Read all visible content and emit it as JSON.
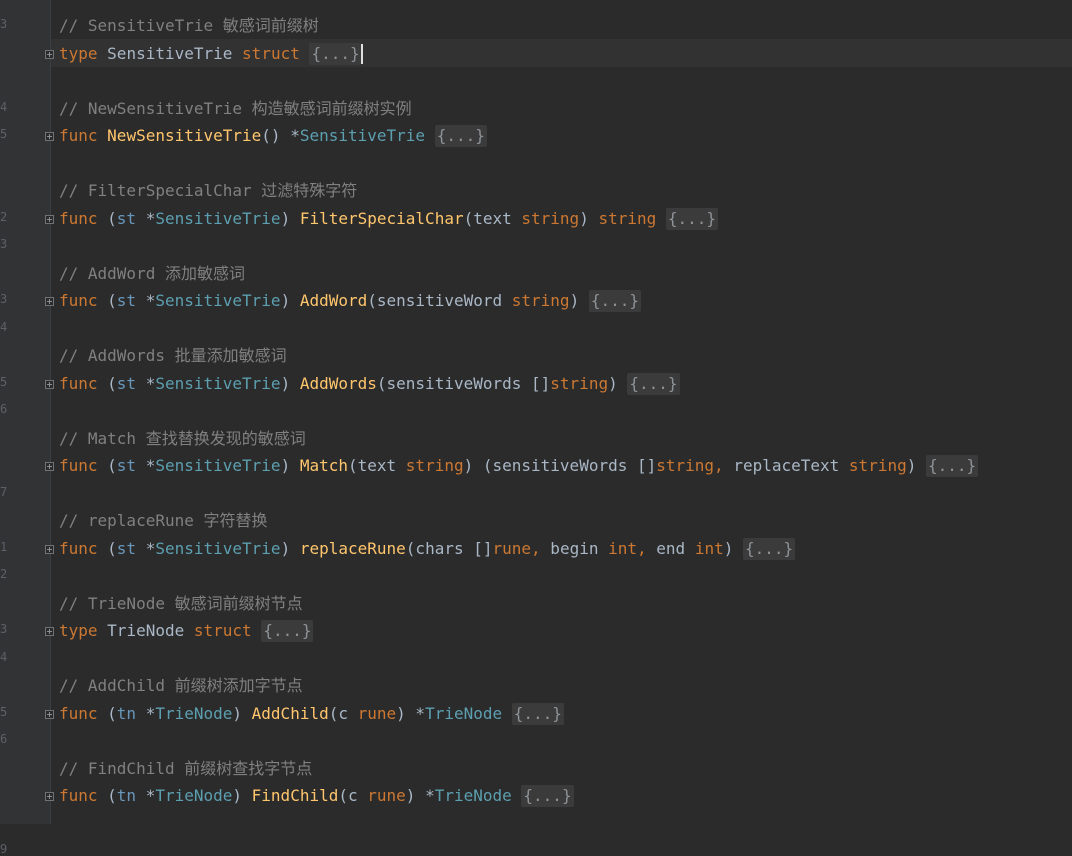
{
  "gutter": {
    "numbers": [
      "3",
      "",
      "",
      "4",
      "5",
      "",
      "",
      "2",
      "3",
      "",
      "3",
      "4",
      "",
      "5",
      "6",
      "",
      "",
      "7",
      "",
      "1",
      "2",
      "",
      "3",
      "4",
      "",
      "5",
      "6",
      "",
      "",
      "",
      "9",
      ""
    ]
  },
  "code": {
    "lines": [
      {
        "type": "comment",
        "text": "// SensitiveTrie 敏感词前缀树"
      },
      {
        "type": "decl",
        "tokens": [
          [
            "kw",
            "type"
          ],
          [
            "pl",
            " "
          ],
          [
            "tyd",
            "SensitiveTrie"
          ],
          [
            "pl",
            " "
          ],
          [
            "kw",
            "struct"
          ],
          [
            "pl",
            " "
          ]
        ],
        "folded": "{...}",
        "caret": true
      },
      {
        "type": "comment",
        "text": "// NewSensitiveTrie 构造敏感词前缀树实例"
      },
      {
        "type": "decl",
        "tokens": [
          [
            "kw",
            "func"
          ],
          [
            "pl",
            " "
          ],
          [
            "fn",
            "NewSensitiveTrie"
          ],
          [
            "pl",
            "() *"
          ],
          [
            "sty",
            "SensitiveTrie"
          ],
          [
            "pl",
            " "
          ]
        ],
        "folded": "{...}"
      },
      {
        "type": "comment",
        "text": "// FilterSpecialChar 过滤特殊字符"
      },
      {
        "type": "decl",
        "tokens": [
          [
            "kw",
            "func"
          ],
          [
            "pl",
            " ("
          ],
          [
            "ty",
            "st"
          ],
          [
            "pl",
            " *"
          ],
          [
            "sty",
            "SensitiveTrie"
          ],
          [
            "pl",
            ") "
          ],
          [
            "fn",
            "FilterSpecialChar"
          ],
          [
            "pl",
            "(text "
          ],
          [
            "kw",
            "string"
          ],
          [
            "pl",
            ") "
          ],
          [
            "kw",
            "string"
          ],
          [
            "pl",
            " "
          ]
        ],
        "folded": "{...}"
      },
      {
        "type": "comment",
        "text": "// AddWord 添加敏感词"
      },
      {
        "type": "decl",
        "tokens": [
          [
            "kw",
            "func"
          ],
          [
            "pl",
            " ("
          ],
          [
            "ty",
            "st"
          ],
          [
            "pl",
            " *"
          ],
          [
            "sty",
            "SensitiveTrie"
          ],
          [
            "pl",
            ") "
          ],
          [
            "fn",
            "AddWord"
          ],
          [
            "pl",
            "(sensitiveWord "
          ],
          [
            "kw",
            "string"
          ],
          [
            "pl",
            ") "
          ]
        ],
        "folded": "{...}"
      },
      {
        "type": "comment",
        "text": "// AddWords 批量添加敏感词"
      },
      {
        "type": "decl",
        "tokens": [
          [
            "kw",
            "func"
          ],
          [
            "pl",
            " ("
          ],
          [
            "ty",
            "st"
          ],
          [
            "pl",
            " *"
          ],
          [
            "sty",
            "SensitiveTrie"
          ],
          [
            "pl",
            ") "
          ],
          [
            "fn",
            "AddWords"
          ],
          [
            "pl",
            "(sensitiveWords []"
          ],
          [
            "kw",
            "string"
          ],
          [
            "pl",
            ") "
          ]
        ],
        "folded": "{...}"
      },
      {
        "type": "comment",
        "text": "// Match 查找替换发现的敏感词"
      },
      {
        "type": "decl",
        "tokens": [
          [
            "kw",
            "func"
          ],
          [
            "pl",
            " ("
          ],
          [
            "ty",
            "st"
          ],
          [
            "pl",
            " *"
          ],
          [
            "sty",
            "SensitiveTrie"
          ],
          [
            "pl",
            ") "
          ],
          [
            "fn",
            "Match"
          ],
          [
            "pl",
            "(text "
          ],
          [
            "kw",
            "string"
          ],
          [
            "pl",
            ") (sensitiveWords []"
          ],
          [
            "kw",
            "string,"
          ],
          [
            "pl",
            " replaceText "
          ],
          [
            "kw",
            "string"
          ],
          [
            "pl",
            ") "
          ]
        ],
        "folded": "{...}"
      },
      {
        "type": "comment",
        "text": "// replaceRune 字符替换"
      },
      {
        "type": "decl",
        "tokens": [
          [
            "kw",
            "func"
          ],
          [
            "pl",
            " ("
          ],
          [
            "ty",
            "st"
          ],
          [
            "pl",
            " *"
          ],
          [
            "sty",
            "SensitiveTrie"
          ],
          [
            "pl",
            ") "
          ],
          [
            "fn",
            "replaceRune"
          ],
          [
            "pl",
            "(chars []"
          ],
          [
            "kw",
            "rune,"
          ],
          [
            "pl",
            " begin "
          ],
          [
            "kw",
            "int,"
          ],
          [
            "pl",
            " end "
          ],
          [
            "kw",
            "int"
          ],
          [
            "pl",
            ") "
          ]
        ],
        "folded": "{...}"
      },
      {
        "type": "comment",
        "text": "// TrieNode 敏感词前缀树节点"
      },
      {
        "type": "decl",
        "tokens": [
          [
            "kw",
            "type"
          ],
          [
            "pl",
            " "
          ],
          [
            "tyd",
            "TrieNode"
          ],
          [
            "pl",
            " "
          ],
          [
            "kw",
            "struct"
          ],
          [
            "pl",
            " "
          ]
        ],
        "folded": "{...}"
      },
      {
        "type": "comment",
        "text": "// AddChild 前缀树添加字节点"
      },
      {
        "type": "decl",
        "tokens": [
          [
            "kw",
            "func"
          ],
          [
            "pl",
            " ("
          ],
          [
            "ty",
            "tn"
          ],
          [
            "pl",
            " *"
          ],
          [
            "sty",
            "TrieNode"
          ],
          [
            "pl",
            ") "
          ],
          [
            "fn",
            "AddChild"
          ],
          [
            "pl",
            "(c "
          ],
          [
            "kw",
            "rune"
          ],
          [
            "pl",
            ") *"
          ],
          [
            "sty",
            "TrieNode"
          ],
          [
            "pl",
            " "
          ]
        ],
        "folded": "{...}"
      },
      {
        "type": "comment",
        "text": "// FindChild 前缀树查找字节点"
      },
      {
        "type": "decl",
        "tokens": [
          [
            "kw",
            "func"
          ],
          [
            "pl",
            " ("
          ],
          [
            "ty",
            "tn"
          ],
          [
            "pl",
            " *"
          ],
          [
            "sty",
            "TrieNode"
          ],
          [
            "pl",
            ") "
          ],
          [
            "fn",
            "FindChild"
          ],
          [
            "pl",
            "(c "
          ],
          [
            "kw",
            "rune"
          ],
          [
            "pl",
            ") *"
          ],
          [
            "sty",
            "TrieNode"
          ],
          [
            "pl",
            " "
          ]
        ],
        "folded": "{...}"
      }
    ]
  }
}
